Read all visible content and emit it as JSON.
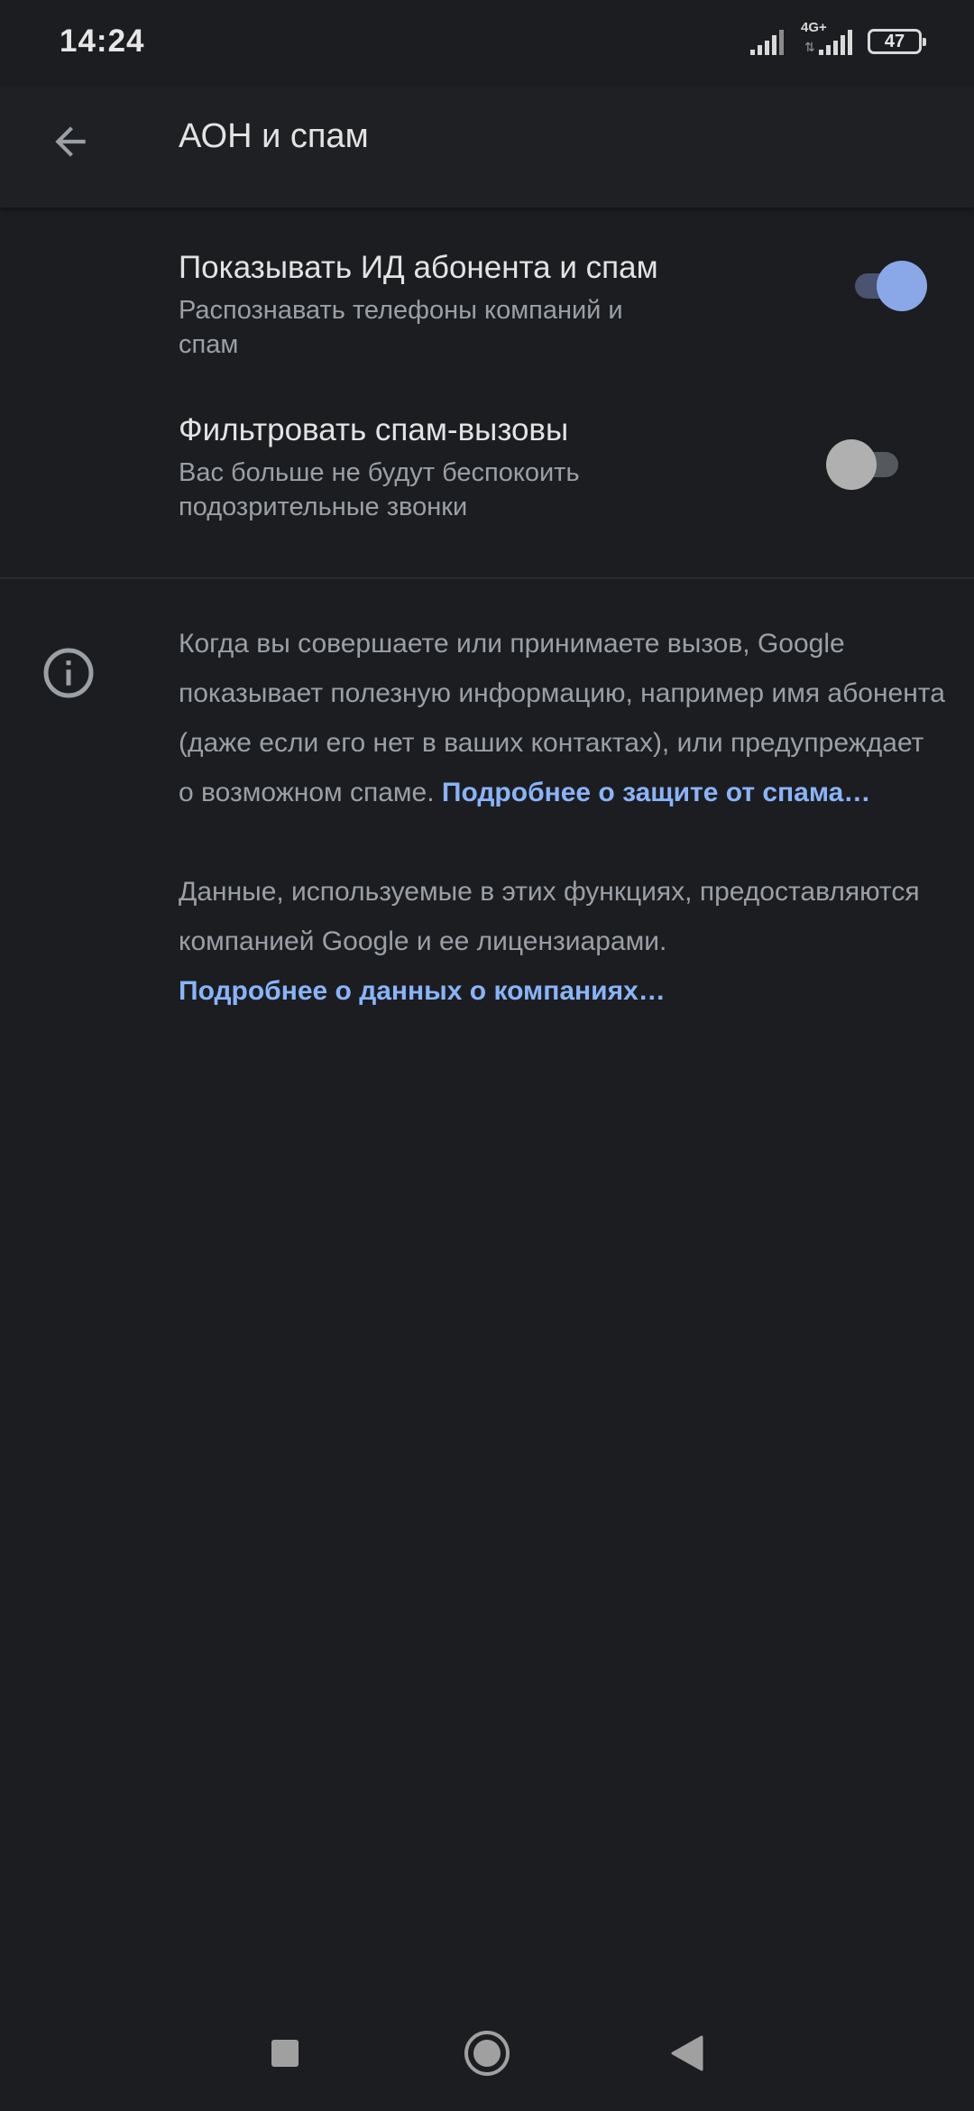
{
  "status_bar": {
    "time": "14:24",
    "network_type": "4G+",
    "battery_level": "47"
  },
  "app_bar": {
    "title": "АОН и спам",
    "back_icon": "arrow-back-icon"
  },
  "settings": [
    {
      "title": "Показывать ИД абонента и спам",
      "subtitle": "Распознавать телефоны компаний и спам",
      "enabled": true
    },
    {
      "title": "Фильтровать спам-вызовы",
      "subtitle": "Вас больше не будут беспокоить подозрительные звонки",
      "enabled": false
    }
  ],
  "info": {
    "icon": "info-icon",
    "paragraph1_text": "Когда вы совершаете или принимаете вызов, Google показывает полезную информацию, например имя абонента (даже если его нет в ваших контактах), или предупреждает о возможном спаме. ",
    "paragraph1_link": "Подробнее о защите от спама…",
    "paragraph2_text": "Данные, используемые в этих функциях, предоставляются компанией Google и ее лицензиарами. ",
    "paragraph2_link": "Подробнее о данных о компаниях…"
  },
  "nav_bar": {
    "recents_icon": "square-recents-icon",
    "home_icon": "circle-home-icon",
    "back_icon": "triangle-back-icon"
  },
  "colors": {
    "background": "#1c1d21",
    "accent": "#8ab4f8",
    "toggle_on": "#8aa7e8",
    "toggle_off": "#b0b0b0"
  }
}
